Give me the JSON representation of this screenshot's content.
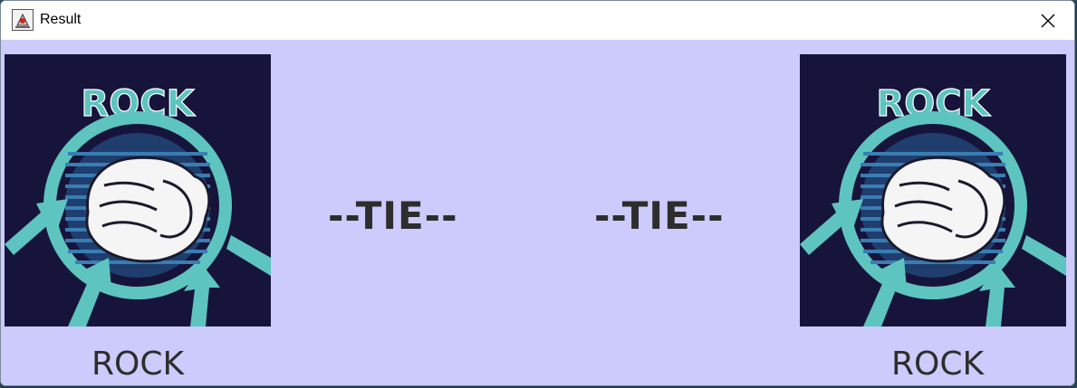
{
  "window": {
    "title": "Result",
    "app_icon": "java-cup-icon",
    "close_icon": "close-icon"
  },
  "player": {
    "image_label": "ROCK",
    "choice": "ROCK",
    "image_icon": "rock-fist-icon"
  },
  "computer": {
    "image_label": "ROCK",
    "choice": "ROCK",
    "image_icon": "rock-fist-icon"
  },
  "result": {
    "left_text": "--TIE--",
    "right_text": "--TIE--"
  },
  "colors": {
    "background": "#cccbfb",
    "image_bg": "#17143b",
    "accent_teal": "#5ec4c0",
    "text": "#2d2d2d"
  }
}
